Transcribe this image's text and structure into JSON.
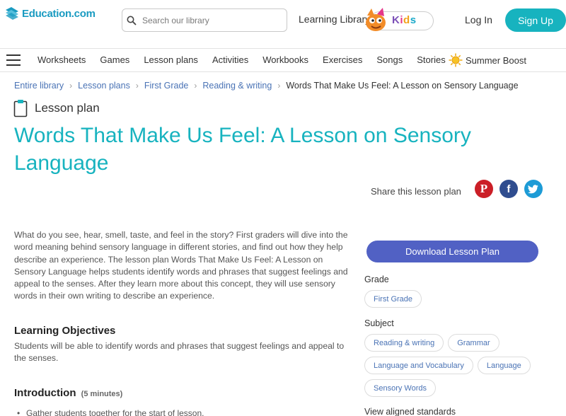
{
  "header": {
    "logo_text": "Education.com",
    "search_placeholder": "Search our library",
    "learning_library": "Learning Library",
    "kids_letters": [
      "K",
      "i",
      "d",
      "s"
    ],
    "login": "Log In",
    "signup": "Sign Up"
  },
  "nav": {
    "items": [
      "Worksheets",
      "Games",
      "Lesson plans",
      "Activities",
      "Workbooks",
      "Exercises",
      "Songs",
      "Stories"
    ],
    "summer": "Summer Boost"
  },
  "breadcrumb": [
    "Entire library",
    "Lesson plans",
    "First Grade",
    "Reading & writing",
    "Words That Make Us Feel: A Lesson on Sensory Language"
  ],
  "content_type": "Lesson plan",
  "title": "Words That Make Us Feel: A Lesson on Sensory Language",
  "share": {
    "label": "Share this lesson plan",
    "icons": [
      "pinterest-icon",
      "facebook-icon",
      "twitter-icon"
    ]
  },
  "description": "What do you see, hear, smell, taste, and feel in the story? First graders will dive into the word meaning behind sensory language in different stories, and find out how they help describe an experience. The lesson plan Words That Make Us Feel: A Lesson on Sensory Language helps students identify words and phrases that suggest feelings and appeal to the senses. After they learn more about this concept, they will use sensory words in their own writing to describe an experience.",
  "objectives": {
    "heading": "Learning Objectives",
    "text": "Students will be able to identify words and phrases that suggest feelings and appeal to the senses."
  },
  "introduction": {
    "heading": "Introduction",
    "duration": "(5 minutes)",
    "first_bullet": "Gather students together for the start of lesson."
  },
  "sidebar": {
    "download": "Download Lesson Plan",
    "grade_label": "Grade",
    "grades": [
      "First Grade"
    ],
    "subject_label": "Subject",
    "subjects_row1": [
      "Reading & writing",
      "Grammar"
    ],
    "subjects_row2": [
      "Language and Vocabulary",
      "Language"
    ],
    "subjects_row3": [
      "Sensory Words"
    ],
    "view_standards": "View aligned standards"
  },
  "colors": {
    "teal": "#17b3bf",
    "link_blue": "#4a73b5",
    "download_button": "#5161c4",
    "pinterest": "#cb1f27",
    "facebook": "#2f4d8f",
    "twitter": "#1d9bd6"
  }
}
